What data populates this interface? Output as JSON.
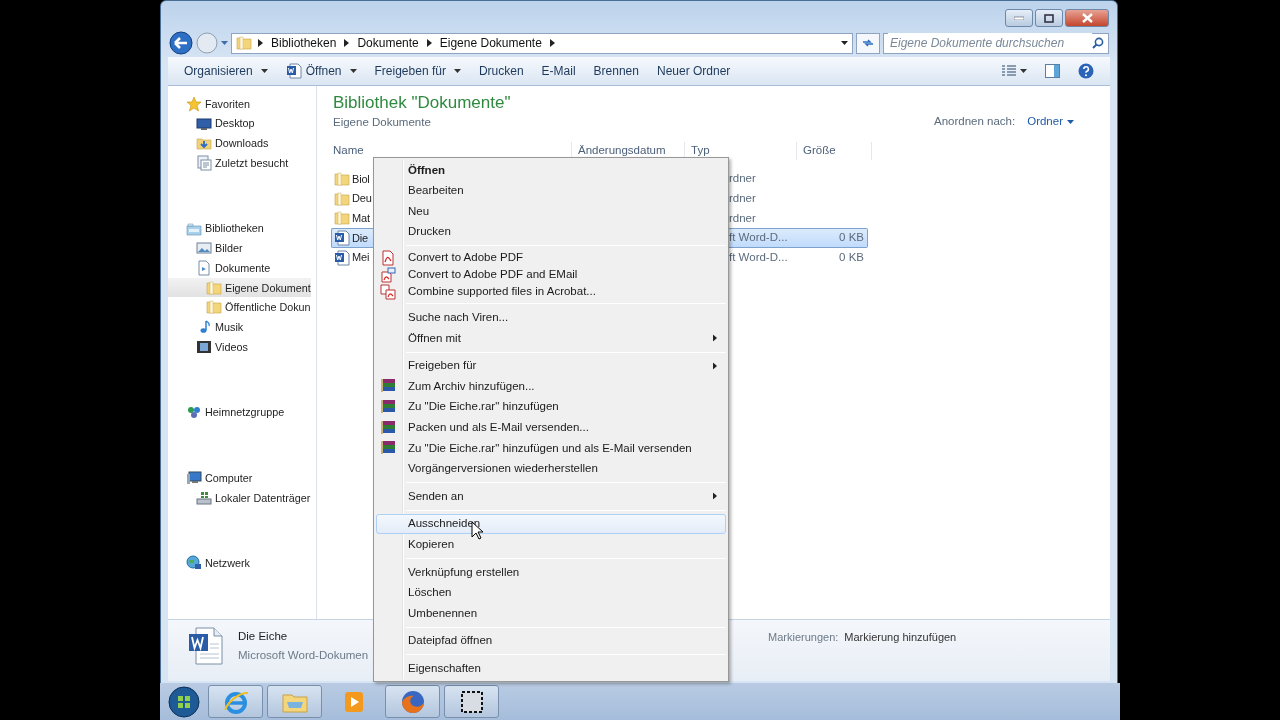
{
  "address_bar": {
    "crumbs": [
      "Bibliotheken",
      "Dokumente",
      "Eigene Dokumente"
    ]
  },
  "search": {
    "placeholder": "Eigene Dokumente durchsuchen"
  },
  "toolbar": {
    "items": [
      {
        "label": "Organisieren",
        "kind": "dropdown"
      },
      {
        "label": "Öffnen",
        "kind": "app-dropdown"
      },
      {
        "label": "Freigeben für",
        "kind": "dropdown"
      },
      {
        "label": "Drucken",
        "kind": "button"
      },
      {
        "label": "E-Mail",
        "kind": "button"
      },
      {
        "label": "Brennen",
        "kind": "button"
      },
      {
        "label": "Neuer Ordner",
        "kind": "button"
      }
    ]
  },
  "sidebar": {
    "groups": [
      {
        "label": "Favoriten",
        "kind": "star",
        "selected": false,
        "children": [
          {
            "label": "Desktop",
            "kind": "desktop",
            "selected": false
          },
          {
            "label": "Downloads",
            "kind": "downloads",
            "selected": false
          },
          {
            "label": "Zuletzt besucht",
            "kind": "recent",
            "selected": false
          }
        ]
      },
      {
        "label": "Bibliotheken",
        "kind": "library",
        "selected": false,
        "children": [
          {
            "label": "Bilder",
            "kind": "pictures",
            "selected": false
          },
          {
            "label": "Dokumente",
            "kind": "documents",
            "selected": false,
            "children": [
              {
                "label": "Eigene Dokument",
                "kind": "folder",
                "selected": true
              },
              {
                "label": "Öffentliche Dokun",
                "kind": "folder",
                "selected": false
              }
            ]
          },
          {
            "label": "Musik",
            "kind": "music",
            "selected": false
          },
          {
            "label": "Videos",
            "kind": "videos",
            "selected": false
          }
        ]
      },
      {
        "label": "Heimnetzgruppe",
        "kind": "homegroup",
        "selected": false
      },
      {
        "label": "Computer",
        "kind": "computer",
        "selected": false,
        "children": [
          {
            "label": "Lokaler Datenträger",
            "kind": "drive",
            "selected": false
          }
        ]
      },
      {
        "label": "Netzwerk",
        "kind": "network",
        "selected": false
      }
    ]
  },
  "library": {
    "title": "Bibliothek \"Dokumente\"",
    "subtitle": "Eigene Dokumente",
    "arrange_label": "Anordnen nach:",
    "arrange_value": "Ordner"
  },
  "file_list": {
    "columns": [
      "Name",
      "Änderungsdatum",
      "Typ",
      "Größe"
    ],
    "rows": [
      {
        "kind": "folder",
        "name": "Biol",
        "type": "rdner",
        "selected": false
      },
      {
        "kind": "folder",
        "name": "Deu",
        "type": "rdner",
        "selected": false
      },
      {
        "kind": "folder",
        "name": "Mat",
        "type": "rdner",
        "selected": false
      },
      {
        "kind": "word",
        "name": "Die",
        "type": "ft Word-D...",
        "size": "0 KB",
        "selected": true
      },
      {
        "kind": "word",
        "name": "Mei",
        "type": "ft Word-D...",
        "size": "0 KB",
        "selected": false
      }
    ]
  },
  "context_menu": {
    "items": [
      {
        "kind": "item",
        "label": "Öffnen",
        "bold": true,
        "selected": false
      },
      {
        "kind": "item",
        "label": "Bearbeiten",
        "selected": false
      },
      {
        "kind": "item",
        "label": "Neu",
        "selected": false
      },
      {
        "kind": "item",
        "label": "Drucken",
        "selected": false
      },
      {
        "kind": "separator"
      },
      {
        "kind": "pdf",
        "label": "Convert to Adobe PDF",
        "selected": false
      },
      {
        "kind": "pdf-mail",
        "label": "Convert to Adobe PDF and EMail",
        "selected": false
      },
      {
        "kind": "acrobat",
        "label": "Combine supported files in Acrobat...",
        "selected": false
      },
      {
        "kind": "separator"
      },
      {
        "kind": "item",
        "label": "Suche nach Viren...",
        "selected": false
      },
      {
        "kind": "item",
        "label": "Öffnen mit",
        "submenu": true,
        "selected": false
      },
      {
        "kind": "separator"
      },
      {
        "kind": "item",
        "label": "Freigeben für",
        "submenu": true,
        "selected": false
      },
      {
        "kind": "rar",
        "label": "Zum Archiv hinzufügen...",
        "selected": false
      },
      {
        "kind": "rar",
        "label": "Zu \"Die Eiche.rar\" hinzufügen",
        "selected": false
      },
      {
        "kind": "rar",
        "label": "Packen und als E-Mail versenden...",
        "selected": false
      },
      {
        "kind": "rar",
        "label": "Zu \"Die Eiche.rar\" hinzufügen und als E-Mail versenden",
        "selected": false
      },
      {
        "kind": "item",
        "label": "Vorgängerversionen wiederherstellen",
        "selected": false
      },
      {
        "kind": "separator"
      },
      {
        "kind": "item",
        "label": "Senden an",
        "submenu": true,
        "selected": false
      },
      {
        "kind": "separator"
      },
      {
        "kind": "item",
        "label": "Ausschneiden",
        "selected": true
      },
      {
        "kind": "item",
        "label": "Kopieren",
        "selected": false
      },
      {
        "kind": "separator"
      },
      {
        "kind": "item",
        "label": "Verknüpfung erstellen",
        "selected": false
      },
      {
        "kind": "item",
        "label": "Löschen",
        "selected": false
      },
      {
        "kind": "item",
        "label": "Umbenennen",
        "selected": false
      },
      {
        "kind": "separator"
      },
      {
        "kind": "item",
        "label": "Dateipfad öffnen",
        "selected": false
      },
      {
        "kind": "separator"
      },
      {
        "kind": "item",
        "label": "Eigenschaften",
        "selected": false
      }
    ]
  },
  "details_pane": {
    "name": "Die Eiche",
    "type": "Microsoft Word-Dokumen",
    "tags_label": "Markierungen:",
    "tags_value": "Markierung hinzufügen"
  },
  "taskbar": {
    "apps": [
      {
        "kind": "ie",
        "running": true
      },
      {
        "kind": "explorer",
        "running": true
      },
      {
        "kind": "media",
        "running": false
      },
      {
        "kind": "firefox",
        "running": true
      },
      {
        "kind": "snip",
        "running": true
      }
    ]
  }
}
